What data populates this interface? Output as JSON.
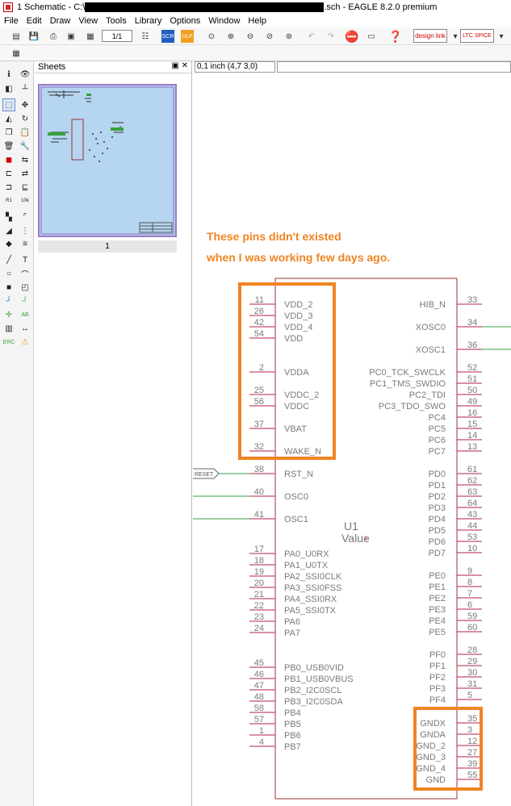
{
  "window": {
    "title_prefix": "1 Schematic - C:\\",
    "title_suffix": ".sch - EAGLE 8.2.0 premium"
  },
  "menu": [
    "File",
    "Edit",
    "Draw",
    "View",
    "Tools",
    "Library",
    "Options",
    "Window",
    "Help"
  ],
  "toolbar": {
    "sheet_select": "1/1",
    "design_link": "design link",
    "ltspice": "LTC SPICE"
  },
  "sheets_panel": {
    "title": "Sheets",
    "controls": "▣ ✕",
    "sheet_number": "1"
  },
  "status": {
    "coordinate": "0,1 inch (4,7 3,0)",
    "command": ""
  },
  "annotation": {
    "line1": "These pins didn't existed",
    "line2": "when I was working few days ago."
  },
  "part": {
    "name": "U1",
    "value": "Value"
  },
  "left_pins": [
    {
      "num": "11",
      "name": "VDD_2"
    },
    {
      "num": "26",
      "name": "VDD_3"
    },
    {
      "num": "42",
      "name": "VDD_4"
    },
    {
      "num": "54",
      "name": "VDD"
    },
    {
      "num": "2",
      "name": "VDDA"
    },
    {
      "num": "25",
      "name": "VDDC_2"
    },
    {
      "num": "56",
      "name": "VDDC"
    },
    {
      "num": "37",
      "name": "VBAT"
    },
    {
      "num": "32",
      "name": "WAKE_N"
    },
    {
      "num": "38",
      "name": "RST_N"
    },
    {
      "num": "40",
      "name": "OSC0"
    },
    {
      "num": "41",
      "name": "OSC1"
    },
    {
      "num": "17",
      "name": "PA0_U0RX"
    },
    {
      "num": "18",
      "name": "PA1_U0TX"
    },
    {
      "num": "19",
      "name": "PA2_SSI0CLK"
    },
    {
      "num": "20",
      "name": "PA3_SSI0FSS"
    },
    {
      "num": "21",
      "name": "PA4_SSI0RX"
    },
    {
      "num": "22",
      "name": "PA5_SSI0TX"
    },
    {
      "num": "23",
      "name": "PA6"
    },
    {
      "num": "24",
      "name": "PA7"
    },
    {
      "num": "45",
      "name": "PB0_USB0VID"
    },
    {
      "num": "46",
      "name": "PB1_USB0VBUS"
    },
    {
      "num": "47",
      "name": "PB2_I2C0SCL"
    },
    {
      "num": "48",
      "name": "PB3_I2C0SDA"
    },
    {
      "num": "58",
      "name": "PB4"
    },
    {
      "num": "57",
      "name": "PB5"
    },
    {
      "num": "1",
      "name": "PB6"
    },
    {
      "num": "4",
      "name": "PB7"
    }
  ],
  "right_pins": [
    {
      "num": "33",
      "name": "HIB_N"
    },
    {
      "num": "34",
      "name": "XOSC0"
    },
    {
      "num": "36",
      "name": "XOSC1"
    },
    {
      "num": "52",
      "name": "PC0_TCK_SWCLK"
    },
    {
      "num": "51",
      "name": "PC1_TMS_SWDIO"
    },
    {
      "num": "50",
      "name": "PC2_TDI"
    },
    {
      "num": "49",
      "name": "PC3_TDO_SWO"
    },
    {
      "num": "16",
      "name": "PC4"
    },
    {
      "num": "15",
      "name": "PC5"
    },
    {
      "num": "14",
      "name": "PC6"
    },
    {
      "num": "13",
      "name": "PC7"
    },
    {
      "num": "61",
      "name": "PD0"
    },
    {
      "num": "62",
      "name": "PD1"
    },
    {
      "num": "63",
      "name": "PD2"
    },
    {
      "num": "64",
      "name": "PD3"
    },
    {
      "num": "43",
      "name": "PD4"
    },
    {
      "num": "44",
      "name": "PD5"
    },
    {
      "num": "53",
      "name": "PD6"
    },
    {
      "num": "10",
      "name": "PD7"
    },
    {
      "num": "9",
      "name": "PE0"
    },
    {
      "num": "8",
      "name": "PE1"
    },
    {
      "num": "7",
      "name": "PE2"
    },
    {
      "num": "6",
      "name": "PE3"
    },
    {
      "num": "59",
      "name": "PE4"
    },
    {
      "num": "60",
      "name": "PE5"
    },
    {
      "num": "28",
      "name": "PF0"
    },
    {
      "num": "29",
      "name": "PF1"
    },
    {
      "num": "30",
      "name": "PF2"
    },
    {
      "num": "31",
      "name": "PF3"
    },
    {
      "num": "5",
      "name": "PF4"
    },
    {
      "num": "35",
      "name": "GNDX"
    },
    {
      "num": "3",
      "name": "GNDA"
    },
    {
      "num": "12",
      "name": "GND_2"
    },
    {
      "num": "27",
      "name": "GND_3"
    },
    {
      "num": "39",
      "name": "GND_4"
    },
    {
      "num": "55",
      "name": "GND"
    }
  ],
  "net_label": "RESET",
  "colors": {
    "pin": "#b0204a",
    "body": "#a03030",
    "text": "#7a7a7a",
    "wire": "#3aa040",
    "highlight": "#f08422"
  }
}
